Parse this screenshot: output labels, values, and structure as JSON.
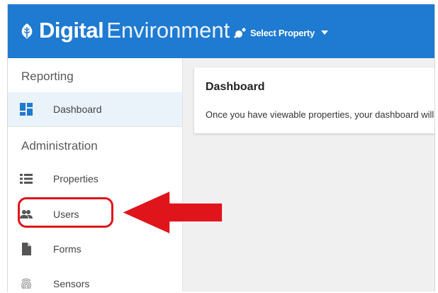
{
  "header": {
    "brand_bold": "Digital",
    "brand_light": "Environment",
    "property_select_label": "Select Property"
  },
  "sidebar": {
    "sections": [
      {
        "title": "Reporting",
        "items": [
          {
            "label": "Dashboard",
            "icon": "dashboard-icon",
            "active": true
          }
        ]
      },
      {
        "title": "Administration",
        "items": [
          {
            "label": "Properties",
            "icon": "list-icon",
            "active": false
          },
          {
            "label": "Users",
            "icon": "users-icon",
            "active": false,
            "highlighted": true
          },
          {
            "label": "Forms",
            "icon": "document-icon",
            "active": false
          },
          {
            "label": "Sensors",
            "icon": "fingerprint-icon",
            "active": false
          }
        ]
      }
    ]
  },
  "main": {
    "card": {
      "title": "Dashboard",
      "text": "Once you have viewable properties, your dashboard will appear here."
    }
  },
  "colors": {
    "header_bg": "#1f7ad1",
    "active_item_bg": "#eaf2fa",
    "annotation_red": "#e0141b",
    "main_bg": "#f0f0f0"
  }
}
